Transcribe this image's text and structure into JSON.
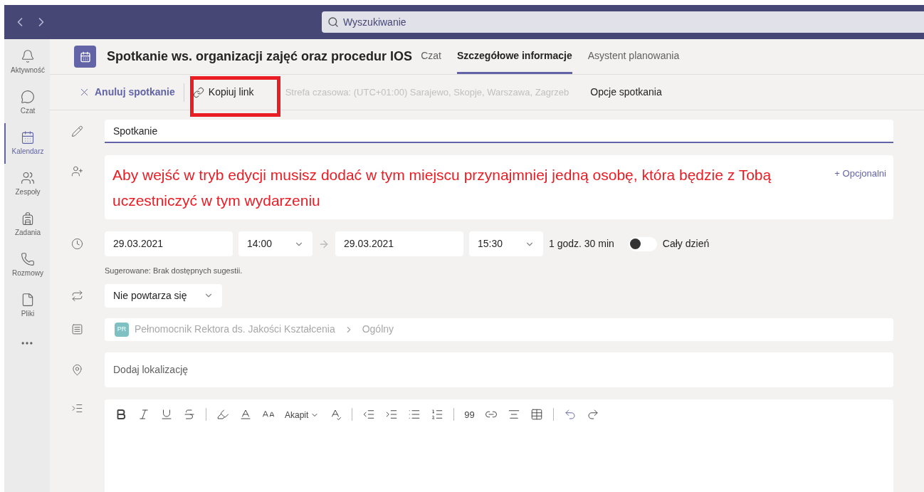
{
  "search": {
    "placeholder": "Wyszukiwanie"
  },
  "sidebar": {
    "items": [
      {
        "label": "Aktywność",
        "kind": "bell",
        "selected": false
      },
      {
        "label": "Czat",
        "kind": "chat",
        "selected": false
      },
      {
        "label": "Kalendarz",
        "kind": "calendar",
        "selected": true
      },
      {
        "label": "Zespoły",
        "kind": "teams",
        "selected": false
      },
      {
        "label": "Zadania",
        "kind": "tasks",
        "selected": false
      },
      {
        "label": "Rozmowy",
        "kind": "phone",
        "selected": false
      },
      {
        "label": "Pliki",
        "kind": "file",
        "selected": false
      }
    ]
  },
  "header": {
    "title": "Spotkanie ws. organizacji zajęć oraz procedur IOS",
    "tabs": [
      {
        "label": "Czat",
        "selected": false
      },
      {
        "label": "Szczegółowe informacje",
        "selected": true
      },
      {
        "label": "Asystent planowania",
        "selected": false
      }
    ]
  },
  "toolbar": {
    "cancel": "Anuluj spotkanie",
    "copy_link": "Kopiuj link",
    "timezone": "Strefa czasowa: (UTC+01:00) Sarajewo, Skopje, Warszawa, Zagrzeb",
    "options": "Opcje spotkania"
  },
  "form": {
    "title_value": "Spotkanie",
    "optional": "+ Opcjonalni",
    "start_date": "29.03.2021",
    "start_time": "14:00",
    "end_date": "29.03.2021",
    "end_time": "15:30",
    "duration": "1 godz. 30 min",
    "all_day": {
      "label": "Cały dzień",
      "on": false
    },
    "suggestion": "Sugerowane: Brak dostępnych sugestii.",
    "repeat": "Nie powtarza się",
    "channel": {
      "badge": "PR",
      "team": "Pełnomocnik Rektora ds. Jakości Kształcenia",
      "name": "Ogólny"
    },
    "location_placeholder": "Dodaj lokalizację",
    "editor_toolbar": [
      {
        "kind": "bold"
      },
      {
        "kind": "italic"
      },
      {
        "kind": "underline"
      },
      {
        "kind": "strike"
      },
      {
        "kind": "sep"
      },
      {
        "kind": "highlight"
      },
      {
        "kind": "fontcolor"
      },
      {
        "kind": "fontsize"
      },
      {
        "kind": "paragraph",
        "label": "Akapit"
      },
      {
        "kind": "clear"
      },
      {
        "kind": "sep"
      },
      {
        "kind": "outdent"
      },
      {
        "kind": "indent"
      },
      {
        "kind": "bullets"
      },
      {
        "kind": "numbers"
      },
      {
        "kind": "sep"
      },
      {
        "kind": "quote",
        "label": "99"
      },
      {
        "kind": "link"
      },
      {
        "kind": "hr"
      },
      {
        "kind": "table"
      },
      {
        "kind": "sep"
      },
      {
        "kind": "undo"
      },
      {
        "kind": "redo"
      }
    ]
  },
  "annotation": {
    "text": "Aby wejść w tryb edycji musisz dodać w tym miejscu przynajmniej jedną osobę, która będzie z Tobą uczestniczyć w tym wydarzeniu"
  }
}
